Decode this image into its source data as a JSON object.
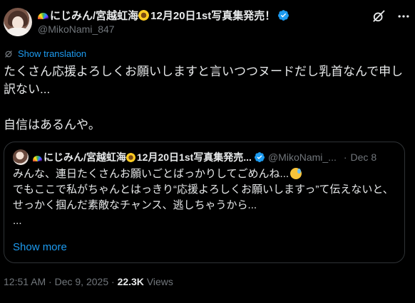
{
  "author": {
    "display_name": "にじみん/宮越虹海",
    "name_suffix": "12月20日1st写真集発売！",
    "handle": "@MikoNami_847",
    "verified": true
  },
  "translate_label": "Show translation",
  "tweet_text": "たくさん応援よろしくお願いしますと言いつつヌードだし乳首なんで申し訳ない...\n\n自信はあるんや。",
  "quote": {
    "display_name": "にじみん/宮越虹海",
    "name_suffix": "12月20日1st写真集発売...",
    "handle": "@MikoNami_...",
    "separator": "·",
    "date": "Dec 8",
    "text_line1": "みんな、連日たくさんお願いごとばっかりしてごめんね...",
    "text_rest": "\nでもここで私がちゃんとはっきり“応援よろしくお願いしますっ”て伝えないと、\nせっかく掴んだ素敵なチャンス、逃しちゃうから...\n...",
    "show_more": "Show more"
  },
  "meta": {
    "time": "12:51 AM",
    "separator": "·",
    "date": "Dec 9, 2025",
    "views_count": "22.3K",
    "views_label": "Views"
  },
  "icons": [
    "rainbow-emoji",
    "sunflower-emoji",
    "verified-badge-icon",
    "grok-icon",
    "more-icon",
    "translate-icon",
    "sweat-smile-emoji"
  ],
  "colors": {
    "background": "#000000",
    "text": "#e7e9ea",
    "muted": "#71767b",
    "accent": "#1d9bf0",
    "border": "#2f3336"
  }
}
